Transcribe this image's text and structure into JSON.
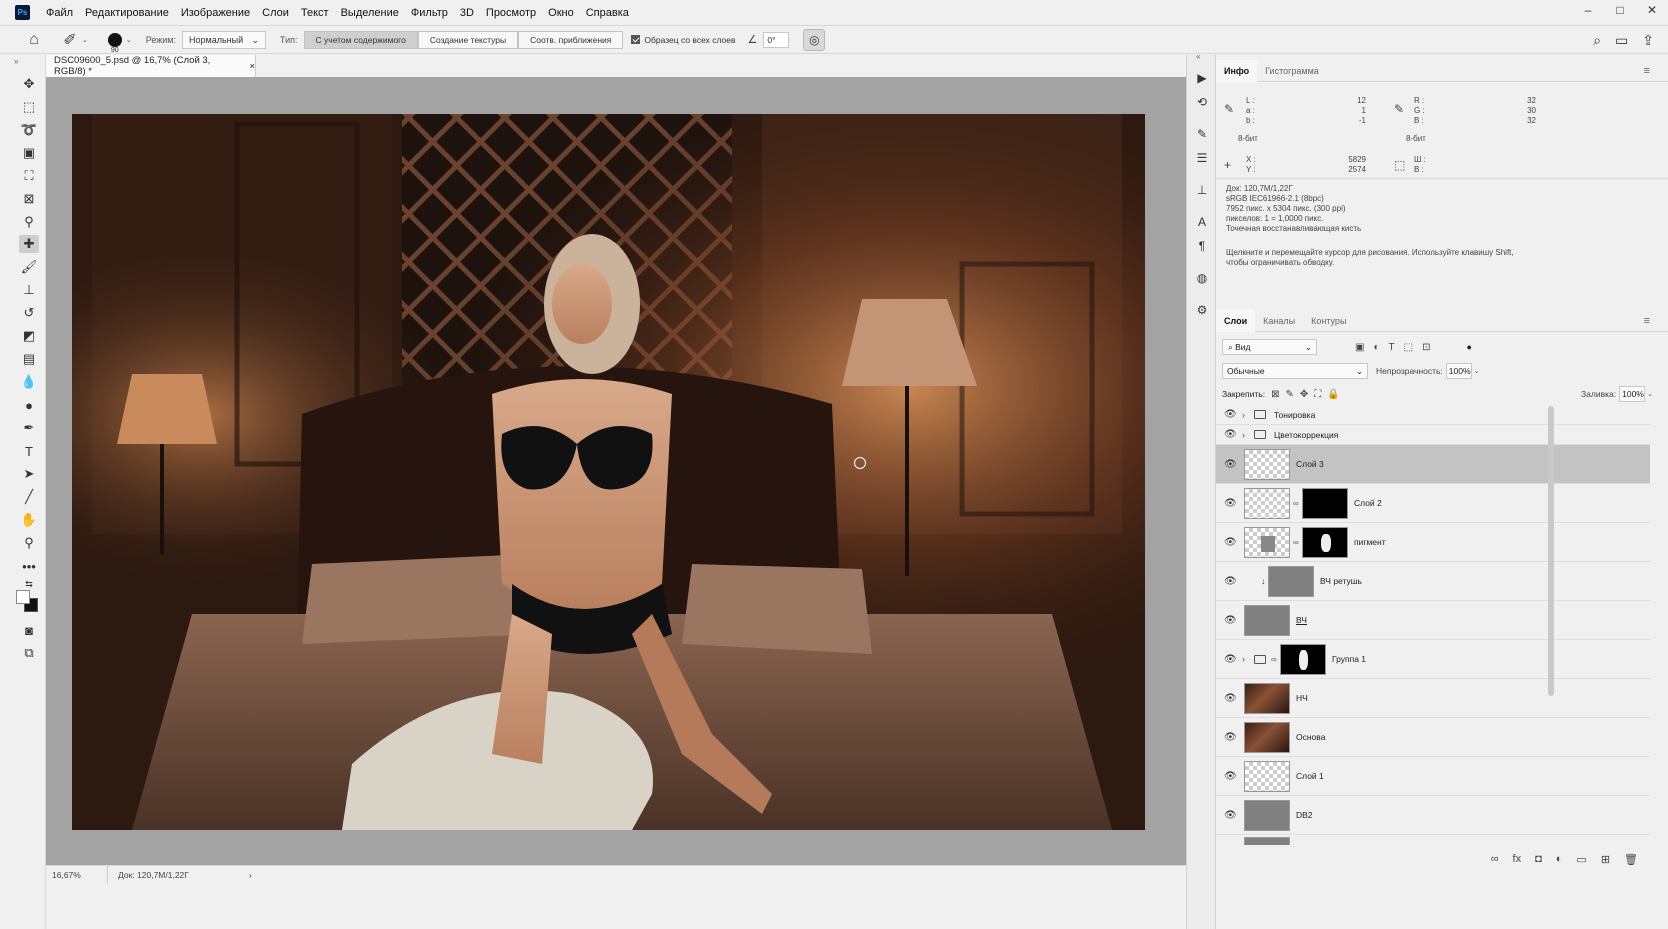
{
  "menubar": {
    "logo": "Ps",
    "items": [
      "Файл",
      "Редактирование",
      "Изображение",
      "Слои",
      "Текст",
      "Выделение",
      "Фильтр",
      "3D",
      "Просмотр",
      "Окно",
      "Справка"
    ]
  },
  "options": {
    "brush_size": "90",
    "mode_label": "Режим:",
    "mode_value": "Нормальный",
    "type_label": "Тип:",
    "type_options": [
      "С учетом содержимого",
      "Создание текстуры",
      "Соотв. приближения"
    ],
    "type_selected": "С учетом содержимого",
    "sample_all_layers": "Образец со всех слоев",
    "angle_value": "0°"
  },
  "document": {
    "tab_title": "DSC09600_5.psd @ 16,7% (Слой 3, RGB/8) *",
    "close": "×"
  },
  "status": {
    "zoom": "16,67%",
    "doc_size": "Док: 120,7M/1,22Г",
    "arrow": "›"
  },
  "info_panel": {
    "tabs": [
      "Инфо",
      "Гистограмма"
    ],
    "active_tab": "Инфо",
    "lab": {
      "L_label": "L :",
      "L": "12",
      "a_label": "a :",
      "a": "1",
      "b_label": "b :",
      "b": "-1"
    },
    "rgb": {
      "R_label": "R :",
      "R": "32",
      "G_label": "G :",
      "G": "30",
      "B_label": "B :",
      "B": "32"
    },
    "bit_left": "8-бит",
    "bit_right": "8-бит",
    "xy": {
      "X_label": "X :",
      "X": "5829",
      "Y_label": "Y :",
      "Y": "2574"
    },
    "wh": {
      "W_label": "Ш :",
      "H_label": "В :"
    },
    "doc_lines": [
      "Док: 120,7M/1,22Г",
      "sRGB IEC61966-2.1 (8bpc)",
      "7952 пикс. x 5304 пикс. (300 ppi)",
      "пикселов: 1 = 1,0000 пикс.",
      "Точечная восстанавливающая кисть"
    ],
    "hint_line1": "Щелкните и перемещайте курсор для рисования. Используйте клавишу Shift,",
    "hint_line2": "чтобы ограничивать обводку."
  },
  "layers_panel": {
    "tabs": [
      "Слои",
      "Каналы",
      "Контуры"
    ],
    "active_tab": "Слои",
    "filter_value": "Вид",
    "blend_mode": "Обычные",
    "opacity_label": "Непрозрачность:",
    "opacity_value": "100%",
    "lock_label": "Закрепить:",
    "fill_label": "Заливка:",
    "fill_value": "100%",
    "layers": [
      {
        "name": "Тонировка",
        "kind": "group"
      },
      {
        "name": "Цветокоррекция",
        "kind": "group"
      },
      {
        "name": "Слой 3",
        "kind": "transparent",
        "selected": true
      },
      {
        "name": "Слой 2",
        "kind": "transparent-mask"
      },
      {
        "name": "пигмент",
        "kind": "gray-mask"
      },
      {
        "name": "ВЧ ретушь",
        "kind": "clipped"
      },
      {
        "name": "ВЧ",
        "kind": "gray"
      },
      {
        "name": "Группа 1",
        "kind": "group-mask"
      },
      {
        "name": "НЧ",
        "kind": "photo"
      },
      {
        "name": "Основа",
        "kind": "photo"
      },
      {
        "name": "Слой 1",
        "kind": "transparent"
      },
      {
        "name": "DB2",
        "kind": "gray"
      }
    ]
  },
  "colors": {
    "accent_ps": "#31a8ff",
    "selected_layer": "#c3c3c3",
    "canvas_bg": "#a3a3a3"
  }
}
